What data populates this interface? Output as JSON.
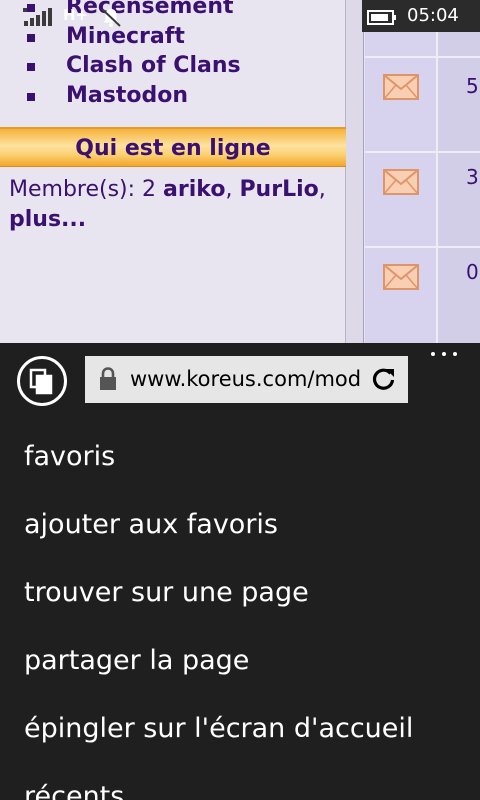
{
  "status_bar": {
    "network": "H+",
    "time": "05:04",
    "icons": [
      "signal-strength-icon",
      "notification-bell-icon",
      "battery-icon"
    ]
  },
  "webpage": {
    "menu_items": [
      "Recensement",
      "Minecraft",
      "Clash of Clans",
      "Mastodon"
    ],
    "online_section": {
      "title": "Qui est en ligne",
      "members_prefix": "Membre(s): 2",
      "member_1": "ariko",
      "separator": ",",
      "member_2": "PurLio",
      "separator_2": ",",
      "more": "plus..."
    },
    "messages_table": {
      "rows": [
        {
          "count": "5"
        },
        {
          "count": "3"
        },
        {
          "count": "0"
        }
      ]
    }
  },
  "browser": {
    "address_bar": {
      "url": "www.koreus.com/mod"
    },
    "menu": {
      "items": [
        "favoris",
        "ajouter aux favoris",
        "trouver sur une page",
        "partager la page",
        "épingler sur l'écran d'accueil",
        "récents"
      ]
    }
  },
  "colors": {
    "page_text": "#3a1070",
    "header_gold": "#fbd072",
    "menu_background": "#1f1f1f",
    "menu_text": "#ffffff"
  }
}
